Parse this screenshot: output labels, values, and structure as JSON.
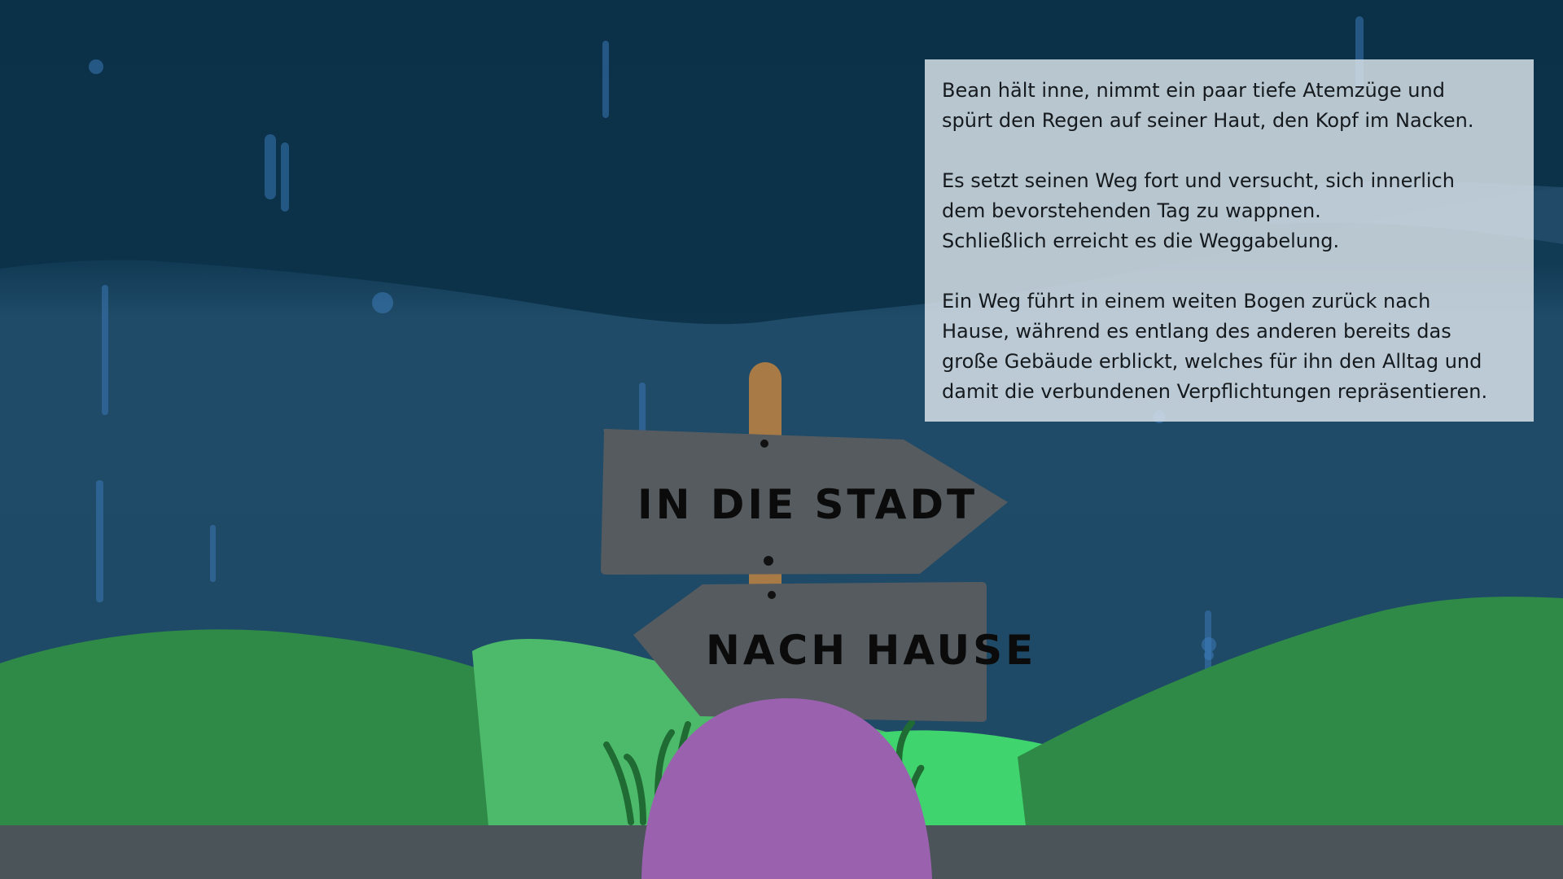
{
  "scene": {
    "signpost": {
      "upper_sign_label": "IN DIE STADT",
      "lower_sign_label": "NACH HAUSE"
    },
    "colors": {
      "sky_top": "#0f3650",
      "sky_bottom": "#1f4a66",
      "hill_dark": "#2f8a47",
      "hill_light": "#4cba6a",
      "hill_bright": "#3fd46d",
      "sign_board": "#555b5f",
      "sign_post": "#a87a45",
      "road": "#4b5458",
      "character": "#9a62ae",
      "rain": "#3f7fc0"
    }
  },
  "narration": {
    "paragraphs": [
      "Bean hält inne, nimmt ein paar tiefe Atemzüge und\nspürt den Regen auf seiner Haut, den Kopf im Nacken.",
      "Es setzt seinen Weg fort und versucht, sich innerlich\ndem bevorstehenden Tag zu wappnen.\nSchließlich erreicht es die Weggabelung.",
      "Ein Weg führt in einem weiten Bogen zurück nach\nHause, während es entlang des anderen bereits das\ngroße Gebäude erblickt, welches für ihn den Alltag und\ndamit die verbundenen Verpflichtungen repräsentieren."
    ]
  }
}
